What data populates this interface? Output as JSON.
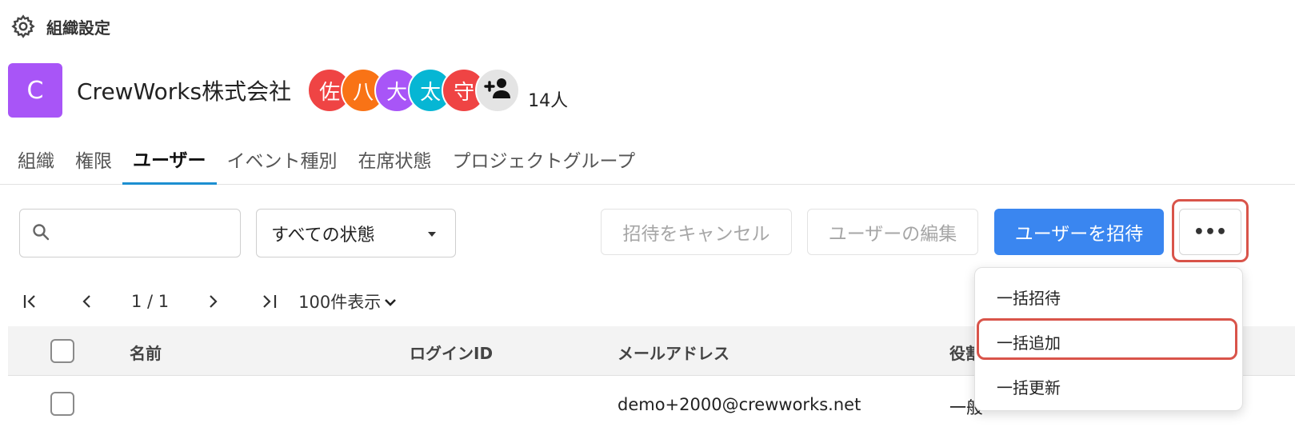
{
  "breadcrumb": {
    "icon": "gear-icon",
    "label": "組織設定"
  },
  "org": {
    "initial": "C",
    "name": "CrewWorks株式会社",
    "avatar_color": "#a855f7",
    "members": [
      {
        "initial": "佐",
        "color": "#ef4444"
      },
      {
        "initial": "八",
        "color": "#f97316"
      },
      {
        "initial": "大",
        "color": "#a855f7"
      },
      {
        "initial": "太",
        "color": "#06b6d4"
      },
      {
        "initial": "守",
        "color": "#ef4444"
      }
    ],
    "member_count": "14人"
  },
  "tabs": [
    {
      "label": "組織",
      "active": false
    },
    {
      "label": "権限",
      "active": false
    },
    {
      "label": "ユーザー",
      "active": true
    },
    {
      "label": "イベント種別",
      "active": false
    },
    {
      "label": "在席状態",
      "active": false
    },
    {
      "label": "プロジェクトグループ",
      "active": false
    }
  ],
  "toolbar": {
    "search_placeholder": "",
    "status_filter": "すべての状態",
    "cancel_invite": "招待をキャンセル",
    "edit_user": "ユーザーの編集",
    "invite_user": "ユーザーを招待",
    "more": "•••"
  },
  "pager": {
    "first": "|<",
    "prev": "<",
    "page_info": "1 / 1",
    "next": ">",
    "last": ">|",
    "per_page": "100件表示"
  },
  "table": {
    "columns": {
      "name": "名前",
      "login_id": "ログインID",
      "email": "メールアドレス",
      "role": "役割"
    },
    "rows": [
      {
        "name": "",
        "login_id": "",
        "email": "demo+2000@crewworks.net",
        "role": "一般"
      }
    ]
  },
  "dropdown": {
    "items": [
      "一括招待",
      "一括追加",
      "一括更新"
    ]
  },
  "colors": {
    "accent": "#1d8fd1",
    "primary_button": "#3a86f0",
    "highlight": "#d9544a"
  }
}
